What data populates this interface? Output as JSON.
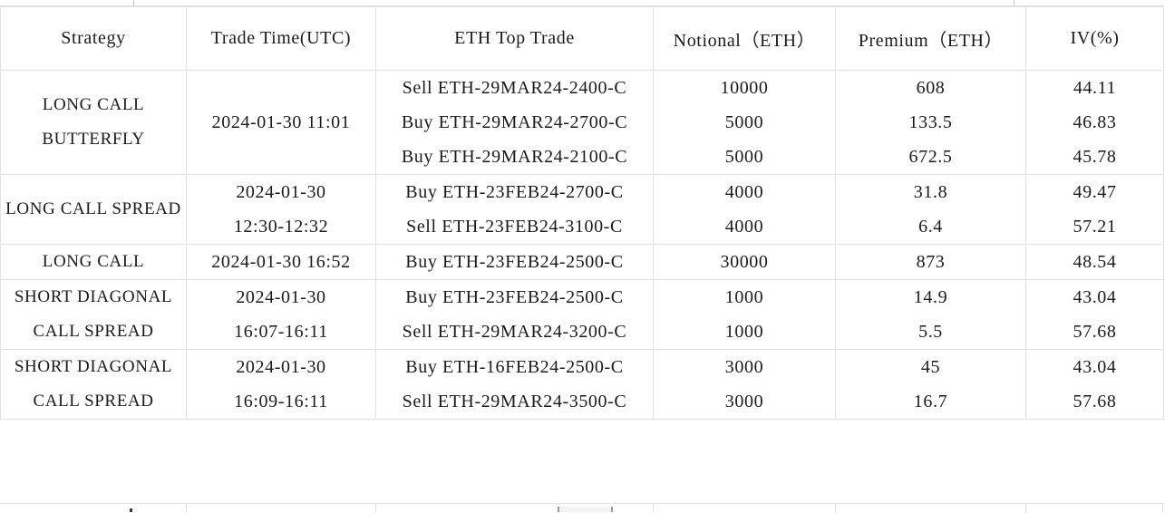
{
  "table": {
    "columns": [
      {
        "key": "strategy",
        "label": "Strategy"
      },
      {
        "key": "trade_time",
        "label": "Trade Time(UTC)"
      },
      {
        "key": "eth_top_trade",
        "label": "ETH Top Trade"
      },
      {
        "key": "notional",
        "label": "Notional（ETH）"
      },
      {
        "key": "premium",
        "label": "Premium（ETH）"
      },
      {
        "key": "iv",
        "label": "IV(%)"
      }
    ],
    "rows": [
      {
        "strategy": [
          "LONG CALL",
          "BUTTERFLY"
        ],
        "trade_time": [
          "2024-01-30 11:01"
        ],
        "eth_top_trade": [
          "Sell ETH-29MAR24-2400-C",
          "Buy ETH-29MAR24-2700-C",
          "Buy ETH-29MAR24-2100-C"
        ],
        "notional": [
          "10000",
          "5000",
          "5000"
        ],
        "premium": [
          "608",
          "133.5",
          "672.5"
        ],
        "iv": [
          "44.11",
          "46.83",
          "45.78"
        ]
      },
      {
        "strategy": [
          "LONG CALL SPREAD"
        ],
        "trade_time": [
          "2024-01-30",
          "12:30-12:32"
        ],
        "eth_top_trade": [
          "Buy ETH-23FEB24-2700-C",
          "Sell ETH-23FEB24-3100-C"
        ],
        "notional": [
          "4000",
          "4000"
        ],
        "premium": [
          "31.8",
          "6.4"
        ],
        "iv": [
          "49.47",
          "57.21"
        ]
      },
      {
        "strategy": [
          "LONG CALL"
        ],
        "trade_time": [
          "2024-01-30 16:52"
        ],
        "eth_top_trade": [
          "Buy ETH-23FEB24-2500-C"
        ],
        "notional": [
          "30000"
        ],
        "premium": [
          "873"
        ],
        "iv": [
          "48.54"
        ]
      },
      {
        "strategy": [
          "SHORT DIAGONAL",
          "CALL SPREAD"
        ],
        "trade_time": [
          "2024-01-30",
          "16:07-16:11"
        ],
        "eth_top_trade": [
          "Buy ETH-23FEB24-2500-C",
          "Sell ETH-29MAR24-3200-C"
        ],
        "notional": [
          "1000",
          "1000"
        ],
        "premium": [
          "14.9",
          "5.5"
        ],
        "iv": [
          "43.04",
          "57.68"
        ]
      },
      {
        "strategy": [
          "SHORT DIAGONAL",
          "CALL SPREAD"
        ],
        "trade_time": [
          "2024-01-30",
          "16:09-16:11"
        ],
        "eth_top_trade": [
          "Buy ETH-16FEB24-2500-C",
          "Sell ETH-29MAR24-3500-C"
        ],
        "notional": [
          "3000",
          "3000"
        ],
        "premium": [
          "45",
          "16.7"
        ],
        "iv": [
          "43.04",
          "57.68"
        ]
      }
    ]
  },
  "colors": {
    "grid_line": "#e2e2e2",
    "text": "#1b1b1b",
    "background": "#ffffff"
  }
}
